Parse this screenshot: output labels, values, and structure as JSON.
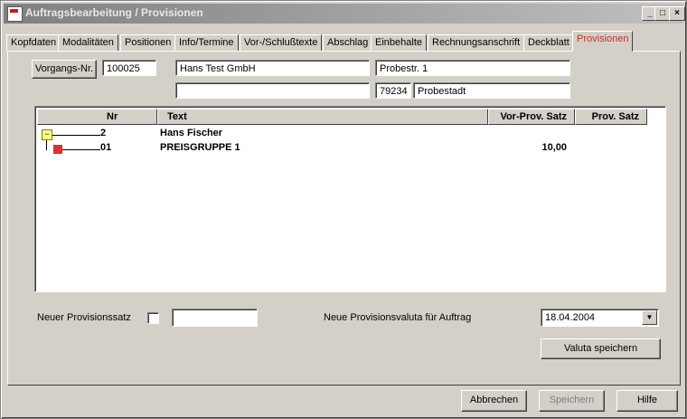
{
  "window": {
    "title": "Auftragsbearbeitung / Provisionen",
    "btn_min": "_",
    "btn_max": "□",
    "btn_close": "×"
  },
  "tabs": [
    {
      "label": "Kopfdaten"
    },
    {
      "label": "Modalitäten"
    },
    {
      "label": "Positionen"
    },
    {
      "label": "Info/Termine"
    },
    {
      "label": "Vor-/Schlußtexte"
    },
    {
      "label": "Abschlag"
    },
    {
      "label": "Einbehalte"
    },
    {
      "label": "Rechnungsanschrift"
    },
    {
      "label": "Deckblatt"
    },
    {
      "label": "Provisionen"
    }
  ],
  "header": {
    "vorgang_button": "Vorgangs-Nr.",
    "vorgang_nr": "100025",
    "customer_name": "Hans Test GmbH",
    "customer_name2": "",
    "street": "Probestr. 1",
    "zip": "79234",
    "city": "Probestadt"
  },
  "table": {
    "columns": [
      "Nr",
      "Text",
      "Vor-Prov. Satz",
      "Prov. Satz"
    ],
    "rows": [
      {
        "nr": "2",
        "text": "Hans Fischer",
        "vor_prov": "",
        "prov": ""
      },
      {
        "nr": "01",
        "text": "PREISGRUPPE 1",
        "vor_prov": "10,00",
        "prov": ""
      }
    ],
    "expand_icon": "minus-box-icon",
    "row_icon": "red-square-icon"
  },
  "bottom": {
    "neuer_satz_label": "Neuer Provisionssatz",
    "neuer_satz_value": "",
    "valuta_label": "Neue Provisionsvaluta für Auftrag",
    "valuta_date": "18.04.2004",
    "valuta_save_button": "Valuta speichern"
  },
  "footer": {
    "cancel": "Abbrechen",
    "save": "Speichern",
    "help": "Hilfe"
  },
  "colors": {
    "active_tab": "#c03030",
    "disabled_text": "#808080"
  }
}
